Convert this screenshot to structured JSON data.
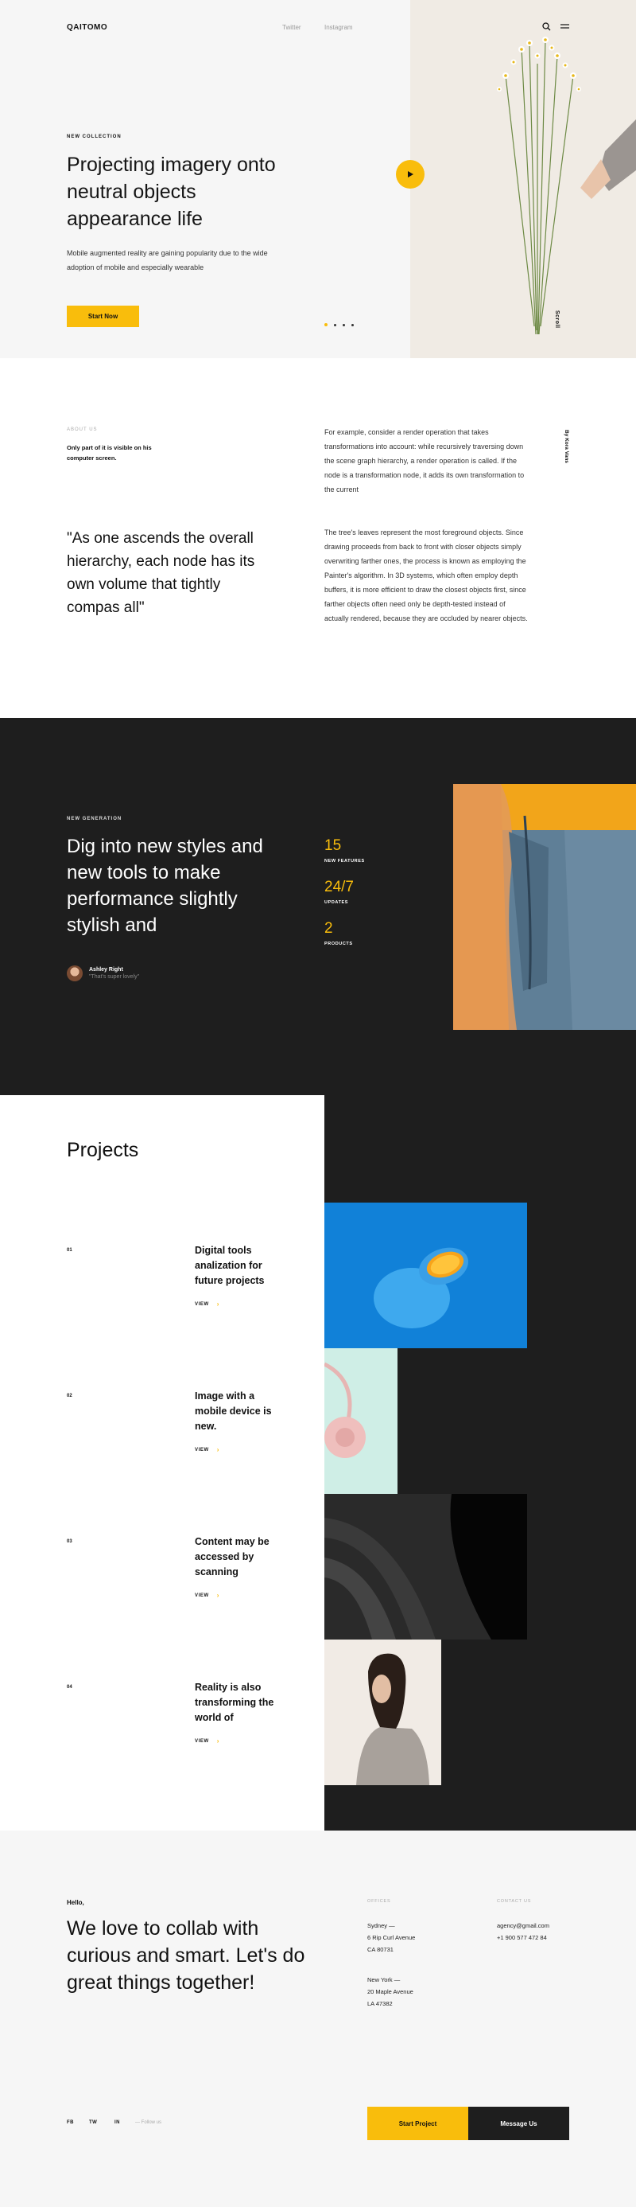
{
  "brand": {
    "logo": "QAITOMO"
  },
  "nav": {
    "links": [
      "Twitter",
      "Instagram"
    ],
    "search_icon": "search-icon",
    "menu_icon": "menu-icon"
  },
  "hero": {
    "eyebrow": "NEW COLLECTION",
    "title": "Projecting imagery onto neutral objects appearance life",
    "description": "Mobile augmented reality are gaining popularity due to the wide adoption of mobile and especially wearable",
    "button": "Start Now",
    "scroll_label": "Scroll",
    "slide_count": 4,
    "active_slide": 1
  },
  "about": {
    "eyebrow": "ABOUT US",
    "subtitle": "Only part of it is visible on his computer screen.",
    "quote": "\"As one ascends the overall hierarchy, each node has its own volume that tightly compas all\"",
    "paragraph_1": "For example, consider a render operation that takes transformations into account: while recursively traversing down the scene graph hierarchy, a render operation is called. If the node is a transformation node, it adds its own transformation to the current",
    "paragraph_2": "The tree's leaves represent the most foreground objects. Since drawing proceeds from back to front with closer objects simply overwriting farther ones, the process is known as employing the Painter's algorithm. In 3D systems, which often employ depth buffers, it is more efficient to draw the closest objects first, since farther objects often need only be depth-tested instead of actually rendered, because they are occluded by nearer objects.",
    "side_label": "By Kora Vans"
  },
  "generation": {
    "eyebrow": "NEW GENERATION",
    "title": "Dig into new styles and new tools to make performance slightly stylish and",
    "author_name": "Ashley Right",
    "author_quote": "\"That's super lovely\"",
    "stats": [
      {
        "value": "15",
        "label": "NEW FEATURES"
      },
      {
        "value": "24/7",
        "label": "UPDATES"
      },
      {
        "value": "2",
        "label": "PRODUCTS"
      }
    ]
  },
  "projects": {
    "title": "Projects",
    "view_label": "VIEW",
    "items": [
      {
        "num": "01",
        "title": "Digital tools analization for future projects"
      },
      {
        "num": "02",
        "title": "Image with a mobile device is new."
      },
      {
        "num": "03",
        "title": "Content may be accessed by scanning"
      },
      {
        "num": "04",
        "title": "Reality is also transforming the world of"
      }
    ]
  },
  "contact": {
    "hello": "Hello,",
    "title": "We love to collab with curious and smart. Let's do great things together!",
    "offices_head": "OFFICES",
    "contact_head": "CONTACT US",
    "sydney": [
      "Sydney —",
      "6 Rip Curl Avenue",
      "CA 80731"
    ],
    "newyork": [
      "New York —",
      "20 Maple Avenue",
      "LA 47382"
    ],
    "email": "agency@gmail.com",
    "phone": "+1 900 577 472 84",
    "socials": [
      "FB",
      "TW",
      "IN"
    ],
    "follow": "— Follow us",
    "cta_primary": "Start Project",
    "cta_secondary": "Message Us"
  },
  "colors": {
    "accent": "#f9bd0c",
    "dark": "#1e1e1e",
    "light": "#f6f6f6"
  }
}
